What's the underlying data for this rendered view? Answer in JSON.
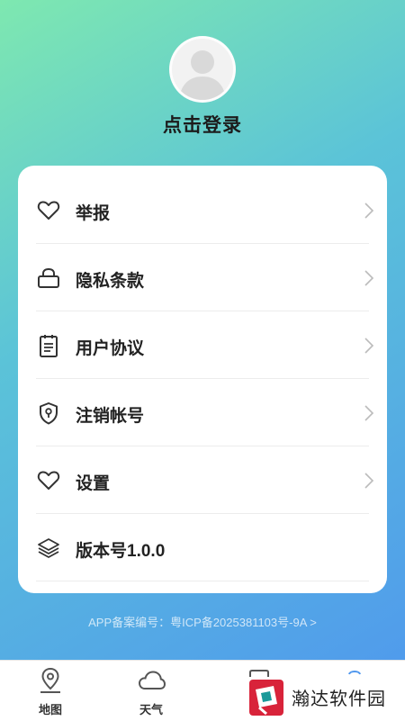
{
  "profile": {
    "login_text": "点击登录"
  },
  "menu": [
    {
      "label": "举报",
      "icon": "heart-icon"
    },
    {
      "label": "隐私条款",
      "icon": "lock-icon"
    },
    {
      "label": "用户协议",
      "icon": "clipboard-icon"
    },
    {
      "label": "注销帐号",
      "icon": "shield-icon"
    },
    {
      "label": "设置",
      "icon": "heart-icon"
    },
    {
      "label": "版本号1.0.0",
      "icon": "layers-icon"
    }
  ],
  "icp": "APP备案编号：粤ICP备2025381103号-9A >",
  "tabs": [
    {
      "label": "地图",
      "icon": "map-pin-icon"
    },
    {
      "label": "天气",
      "icon": "cloud-icon"
    }
  ],
  "watermark": {
    "text": "瀚达软件园"
  }
}
